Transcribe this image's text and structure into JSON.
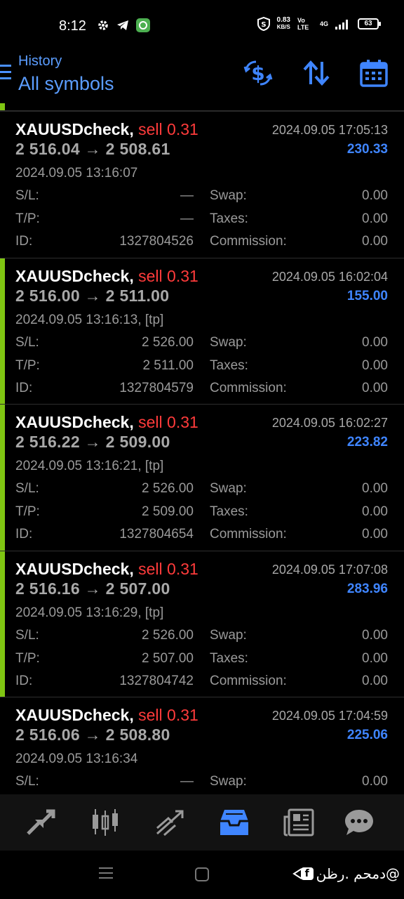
{
  "status_bar": {
    "time": "8:12",
    "speed_value": "0.83",
    "speed_unit": "KB/S",
    "network_label": "Vo LTE",
    "network_type": "4G",
    "battery": "63"
  },
  "header": {
    "subtitle": "History",
    "title": "All symbols",
    "accent_color": "#5b9dff"
  },
  "labels": {
    "sl": "S/L:",
    "tp": "T/P:",
    "id": "ID:",
    "swap": "Swap:",
    "taxes": "Taxes:",
    "commission": "Commission:",
    "arrow": "→"
  },
  "deals": [
    {
      "symbol": "XAUUSDcheck,",
      "side": "sell 0.31",
      "open_price": "2 516.04",
      "close_price": "2 508.61",
      "close_time": "2024.09.05 17:05:13",
      "profit": "230.33",
      "open_time": "2024.09.05 13:16:07",
      "sl": "—",
      "tp": "—",
      "id": "1327804526",
      "swap": "0.00",
      "taxes": "0.00",
      "commission": "0.00",
      "highlighted": false
    },
    {
      "symbol": "XAUUSDcheck,",
      "side": "sell 0.31",
      "open_price": "2 516.00",
      "close_price": "2 511.00",
      "close_time": "2024.09.05 16:02:04",
      "profit": "155.00",
      "open_time": "2024.09.05 13:16:13, [tp]",
      "sl": "2 526.00",
      "tp": "2 511.00",
      "id": "1327804579",
      "swap": "0.00",
      "taxes": "0.00",
      "commission": "0.00",
      "highlighted": true
    },
    {
      "symbol": "XAUUSDcheck,",
      "side": "sell 0.31",
      "open_price": "2 516.22",
      "close_price": "2 509.00",
      "close_time": "2024.09.05 16:02:27",
      "profit": "223.82",
      "open_time": "2024.09.05 13:16:21, [tp]",
      "sl": "2 526.00",
      "tp": "2 509.00",
      "id": "1327804654",
      "swap": "0.00",
      "taxes": "0.00",
      "commission": "0.00",
      "highlighted": true
    },
    {
      "symbol": "XAUUSDcheck,",
      "side": "sell 0.31",
      "open_price": "2 516.16",
      "close_price": "2 507.00",
      "close_time": "2024.09.05 17:07:08",
      "profit": "283.96",
      "open_time": "2024.09.05 13:16:29, [tp]",
      "sl": "2 526.00",
      "tp": "2 507.00",
      "id": "1327804742",
      "swap": "0.00",
      "taxes": "0.00",
      "commission": "0.00",
      "highlighted": true
    },
    {
      "symbol": "XAUUSDcheck,",
      "side": "sell 0.31",
      "open_price": "2 516.06",
      "close_price": "2 508.80",
      "close_time": "2024.09.05 17:04:59",
      "profit": "225.06",
      "open_time": "2024.09.05 13:16:34",
      "sl": "—",
      "tp": "",
      "id": "",
      "swap": "0.00",
      "taxes": "",
      "commission": "",
      "highlighted": false
    }
  ],
  "bottom_nav": {
    "items": [
      "quotes-icon",
      "chart-icon",
      "trade-icon",
      "history-icon",
      "news-icon",
      "chat-icon"
    ],
    "active": "history-icon",
    "active_color": "#3f85ff",
    "inactive_color": "#9a9a9a"
  },
  "watermark": {
    "text": "دمحم .رظن@"
  }
}
